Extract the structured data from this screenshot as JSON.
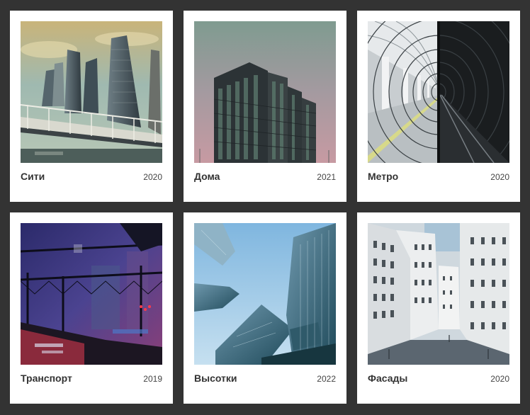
{
  "gallery": {
    "items": [
      {
        "title": "Сити",
        "year": "2020"
      },
      {
        "title": "Дома",
        "year": "2021"
      },
      {
        "title": "Метро",
        "year": "2020"
      },
      {
        "title": "Транспорт",
        "year": "2019"
      },
      {
        "title": "Высотки",
        "year": "2022"
      },
      {
        "title": "Фасады",
        "year": "2020"
      }
    ]
  },
  "colors": {
    "page_background": "#333333",
    "card_background": "#ffffff",
    "title_text": "#333333"
  }
}
